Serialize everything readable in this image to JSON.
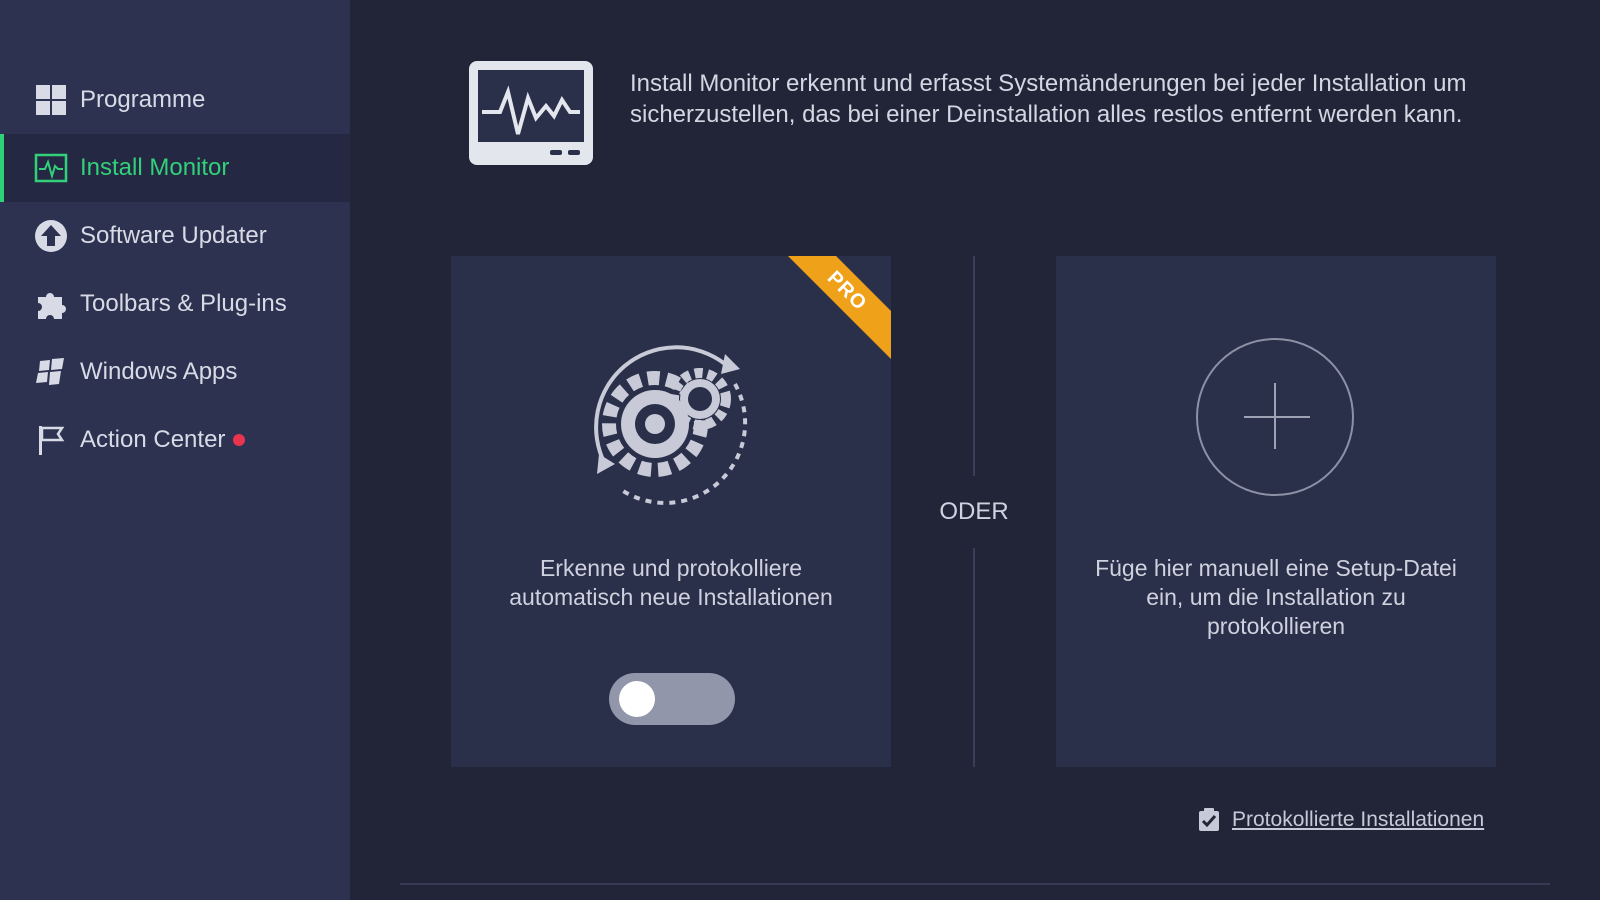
{
  "sidebar": {
    "items": [
      {
        "label": "Programme",
        "icon": "programs-grid-icon",
        "active": false
      },
      {
        "label": "Install Monitor",
        "icon": "install-monitor-icon",
        "active": true
      },
      {
        "label": "Software Updater",
        "icon": "upload-arrow-icon",
        "active": false
      },
      {
        "label": "Toolbars & Plug-ins",
        "icon": "puzzle-icon",
        "active": false
      },
      {
        "label": "Windows Apps",
        "icon": "windows-logo-icon",
        "active": false
      },
      {
        "label": "Action Center",
        "icon": "flag-icon",
        "active": false,
        "notification": true
      }
    ]
  },
  "header": {
    "description": "Install Monitor erkennt und erfasst Systemänderungen bei jeder Installation um sicherzustellen, das bei einer Deinstallation alles restlos entfernt werden kann."
  },
  "auto_card": {
    "badge": "PRO",
    "text_line1": "Erkenne und protokolliere",
    "text_line2": "automatisch neue Installationen",
    "toggle_on": false
  },
  "separator": {
    "label": "ODER"
  },
  "manual_card": {
    "text_line1": "Füge hier manuell eine Setup-Datei",
    "text_line2": "ein, um die Installation zu",
    "text_line3": "protokollieren"
  },
  "footer": {
    "log_link": "Protokollierte Installationen"
  },
  "colors": {
    "sidebar_bg": "#2c3250",
    "main_bg": "#222538",
    "accent_green": "#2ed07a",
    "pro_orange": "#f0a11a",
    "notification_red": "#e8354d"
  }
}
